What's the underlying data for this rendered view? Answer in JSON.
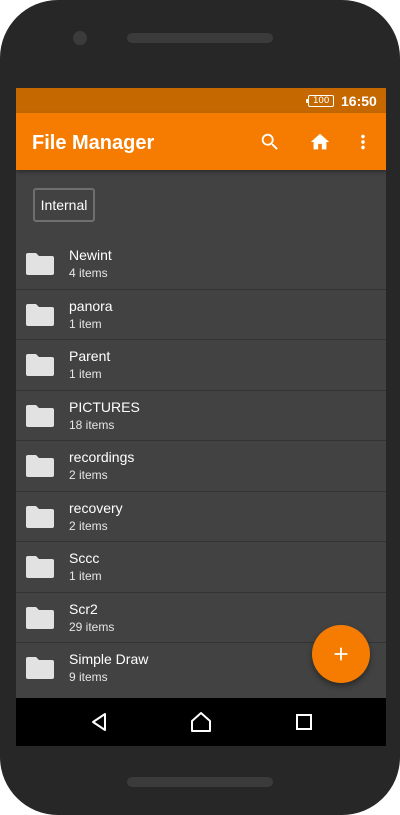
{
  "status_bar": {
    "battery": "100",
    "time": "16:50"
  },
  "app_bar": {
    "title": "File Manager",
    "actions": [
      "search-icon",
      "home-icon",
      "more-vert-icon"
    ]
  },
  "storage_chip": {
    "label": "Internal"
  },
  "folders": [
    {
      "name": "Newint",
      "count": "4 items"
    },
    {
      "name": "panora",
      "count": "1 item"
    },
    {
      "name": "Parent",
      "count": "1 item"
    },
    {
      "name": "PICTURES",
      "count": "18 items"
    },
    {
      "name": "recordings",
      "count": "2 items"
    },
    {
      "name": "recovery",
      "count": "2 items"
    },
    {
      "name": "Sccc",
      "count": "1 item"
    },
    {
      "name": "Scr2",
      "count": "29 items"
    },
    {
      "name": "Simple Draw",
      "count": "9 items"
    }
  ],
  "fab": {
    "icon": "add-icon"
  },
  "nav_bar": {
    "buttons": [
      "back-icon",
      "home-nav-icon",
      "recents-icon"
    ]
  },
  "colors": {
    "accent": "#f57c00",
    "status_bar": "#c66800",
    "background": "#424242",
    "phone_body": "#272727"
  }
}
